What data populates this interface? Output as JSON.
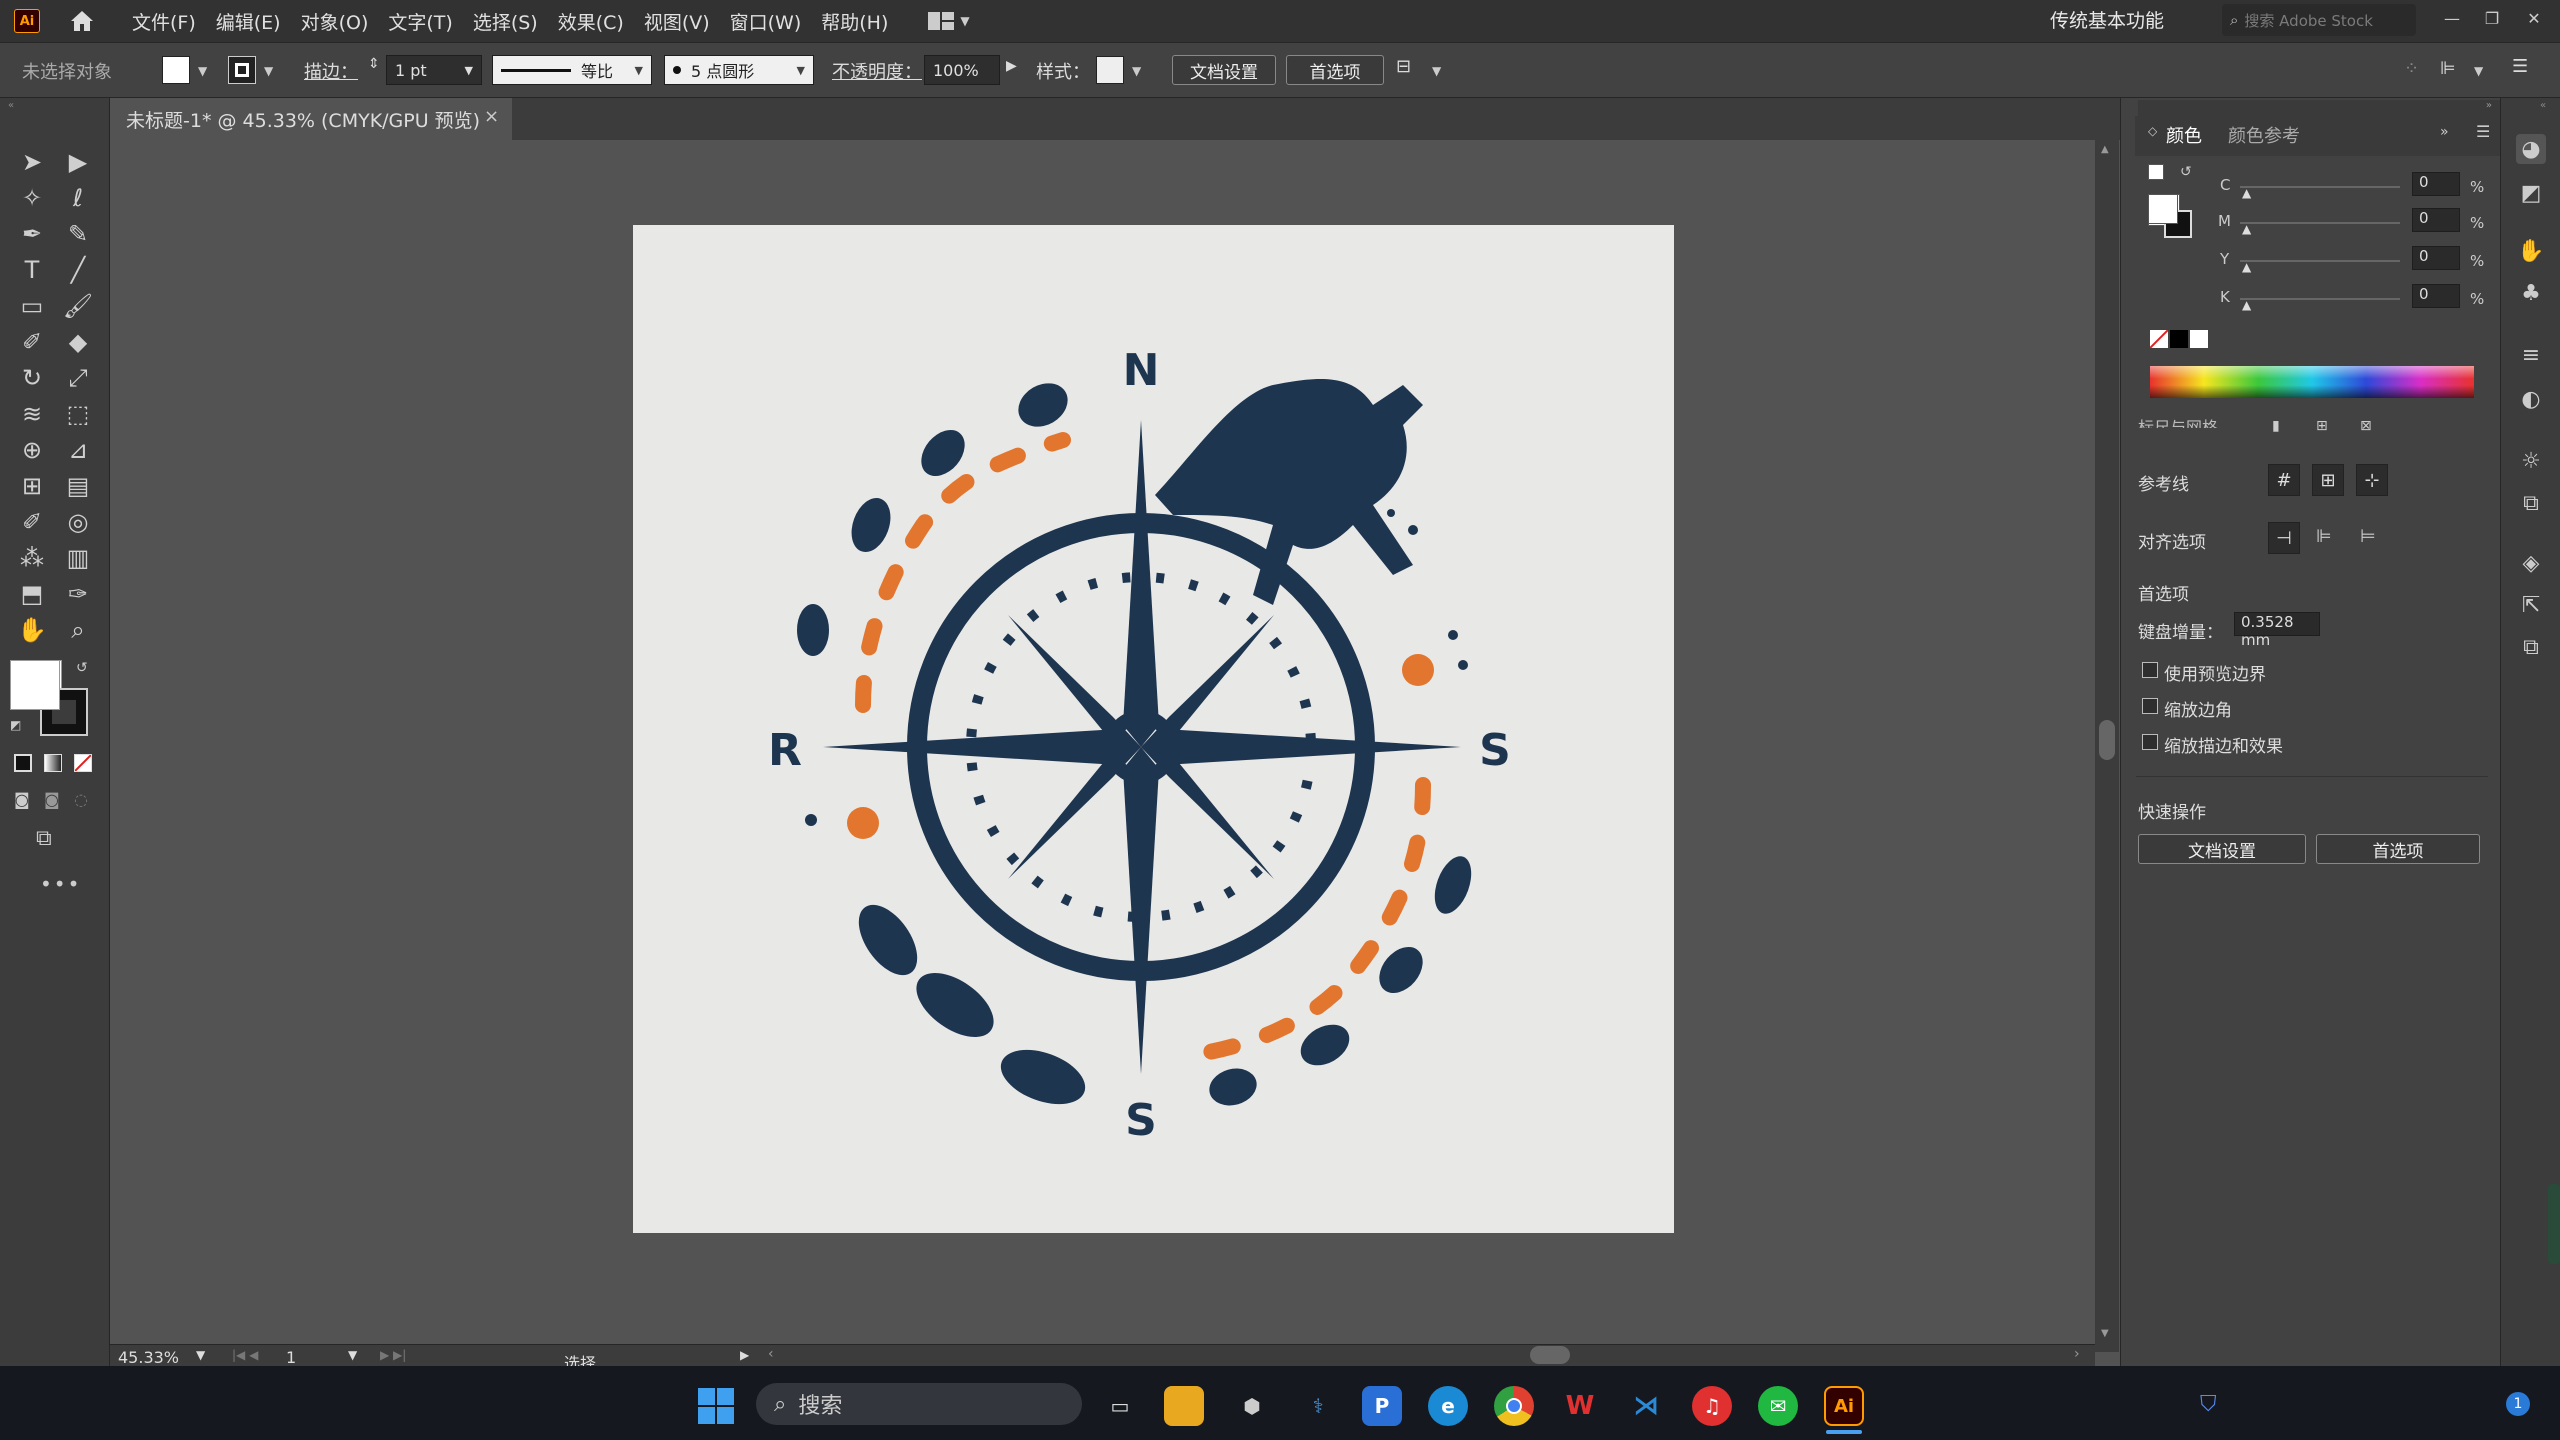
{
  "app": {
    "logo": "Ai"
  },
  "menu": [
    "文件(F)",
    "编辑(E)",
    "对象(O)",
    "文字(T)",
    "选择(S)",
    "效果(C)",
    "视图(V)",
    "窗口(W)",
    "帮助(H)"
  ],
  "workspace": {
    "label": "传统基本功能",
    "stock_placeholder": "搜索 Adobe Stock"
  },
  "control_bar": {
    "selection": "未选择对象",
    "stroke_label": "描边：",
    "stroke_weight": "1 pt",
    "stroke_profile": "等比",
    "brush": "5 点圆形",
    "opacity_label": "不透明度：",
    "opacity": "100%",
    "style_label": "样式：",
    "doc_settings": "文档设置",
    "preferences": "首选项"
  },
  "document_tab": {
    "title": "未标题-1* @ 45.33% (CMYK/GPU 预览)",
    "close": "×"
  },
  "status": {
    "zoom": "45.33%",
    "artboard": "1",
    "tool": "选择"
  },
  "color_panel": {
    "tabs": [
      "颜色",
      "颜色参考"
    ],
    "channels": [
      {
        "label": "C",
        "value": "0",
        "unit": "%"
      },
      {
        "label": "M",
        "value": "0",
        "unit": "%"
      },
      {
        "label": "Y",
        "value": "0",
        "unit": "%"
      },
      {
        "label": "K",
        "value": "0",
        "unit": "%"
      }
    ]
  },
  "properties": {
    "rulers_grid": "标尺与网格",
    "guides": "参考线",
    "snap": "对齐选项",
    "preferences_heading": "首选项",
    "keyboard_increment_label": "键盘增量：",
    "keyboard_increment": "0.3528 mm",
    "checkboxes": [
      "使用预览边界",
      "缩放边角",
      "缩放描边和效果"
    ],
    "quick_actions": "快速操作",
    "doc_settings": "文档设置",
    "preferences": "首选项"
  },
  "artwork": {
    "letters": {
      "north": "N",
      "east": "S",
      "south": "S",
      "west": "R"
    },
    "colors": {
      "navy": "#1e3550",
      "orange": "#e2762f",
      "paper": "#e8e8e6"
    }
  },
  "taskbar": {
    "search_placeholder": "搜索",
    "apps": [
      "windows-start",
      "task-view",
      "file-explorer",
      "app-cube",
      "python",
      "word-like",
      "edge",
      "chrome",
      "wps",
      "vscode",
      "netease-music",
      "wechat",
      "illustrator"
    ],
    "illustrator_label": "Ai",
    "notification_count": "1"
  }
}
